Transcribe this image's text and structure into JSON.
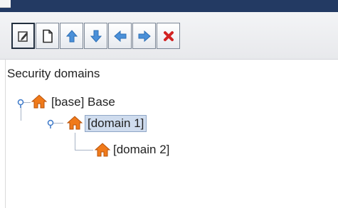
{
  "window": {
    "title": ""
  },
  "toolbar": {
    "buttons": [
      {
        "name": "edit",
        "icon": "edit-icon",
        "color": "#3a3a3a"
      },
      {
        "name": "new",
        "icon": "new-document-icon",
        "color": "#3a3a3a"
      },
      {
        "name": "move-up",
        "icon": "arrow-up-icon",
        "color": "#4a90d9"
      },
      {
        "name": "move-down",
        "icon": "arrow-down-icon",
        "color": "#4a90d9"
      },
      {
        "name": "move-left",
        "icon": "arrow-left-icon",
        "color": "#4a90d9"
      },
      {
        "name": "move-right",
        "icon": "arrow-right-icon",
        "color": "#4a90d9"
      },
      {
        "name": "delete",
        "icon": "delete-icon",
        "color": "#d22323"
      }
    ]
  },
  "tree": {
    "root_label": "Security domains",
    "nodes": [
      {
        "label": "[base] Base",
        "icon": "house-icon",
        "level": 1,
        "expanded": true,
        "selected": false
      },
      {
        "label": "[domain 1]",
        "icon": "house-icon",
        "level": 2,
        "expanded": true,
        "selected": true
      },
      {
        "label": "[domain 2]",
        "icon": "house-icon",
        "level": 3,
        "expanded": false,
        "selected": false
      }
    ],
    "colors": {
      "house": "#f07a1a",
      "selection_bg": "#cfdcee",
      "connector": "#a8b4c6",
      "toggle": "#3d79c9"
    }
  }
}
